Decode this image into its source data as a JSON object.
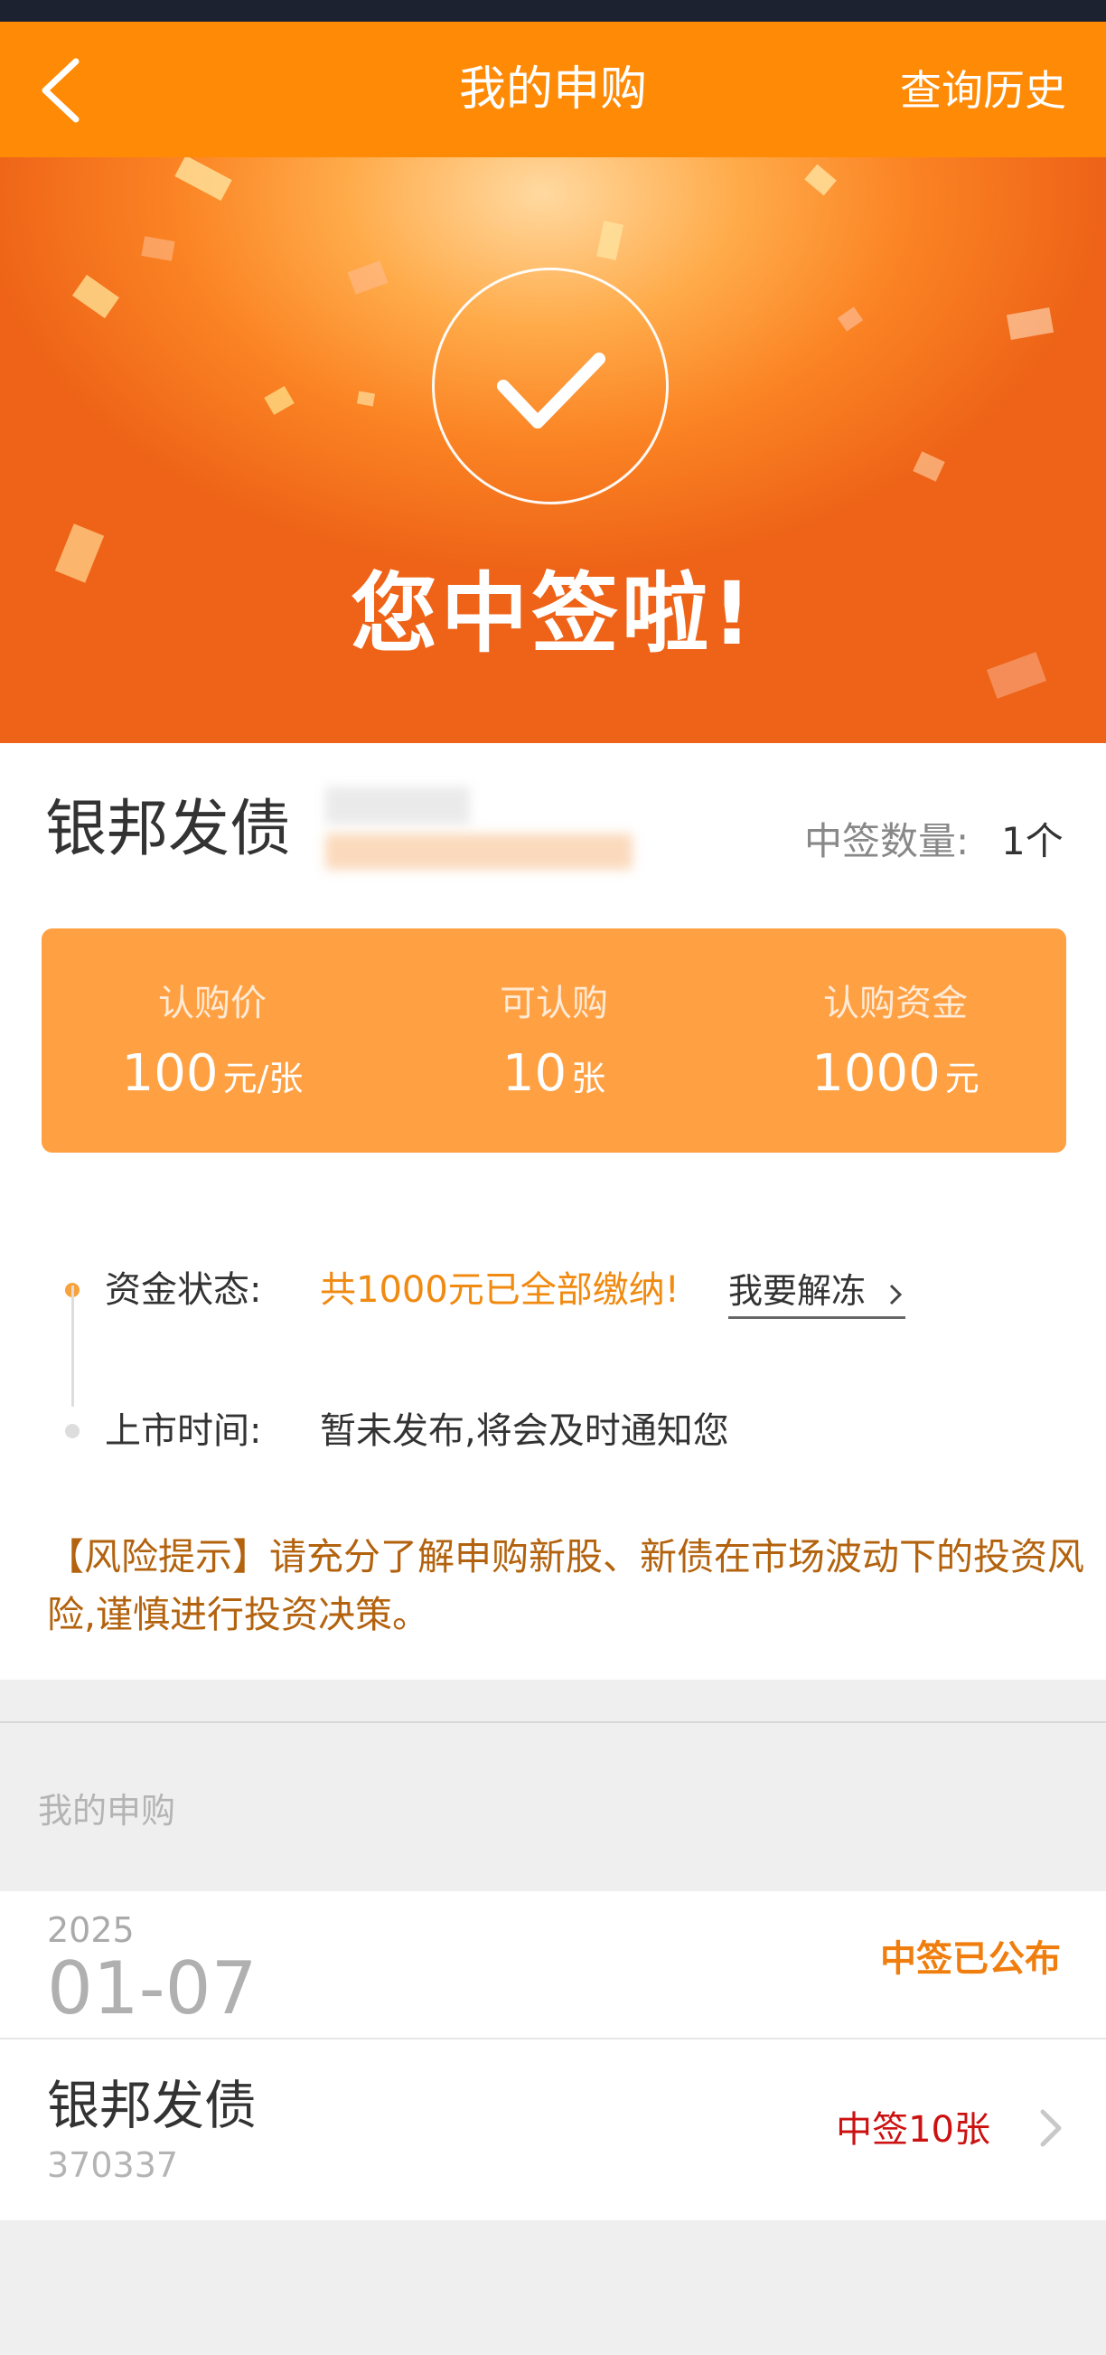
{
  "nav": {
    "title": "我的申购",
    "history_link": "查询历史"
  },
  "banner": {
    "title": "您中签啦!"
  },
  "subscription": {
    "bond_name": "银邦发债",
    "win_count_label": "中签数量:",
    "win_count_value": "1个",
    "summary": [
      {
        "label": "认购价",
        "value": "100",
        "unit": "元/张"
      },
      {
        "label": "可认购",
        "value": "10",
        "unit": "张"
      },
      {
        "label": "认购资金",
        "value": "1000",
        "unit": "元"
      }
    ],
    "fund_status": {
      "label": "资金状态:",
      "value": "共1000元已全部缴纳!",
      "action": "我要解冻"
    },
    "listing": {
      "label": "上市时间:",
      "value": "暂未发布,将会及时通知您"
    },
    "risk_notice": "【风险提示】请充分了解申购新股、新债在市场波动下的投资风险,谨慎进行投资决策。"
  },
  "history": {
    "section_title": "我的申购",
    "date_year": "2025",
    "date_md": "01-07",
    "date_status": "中签已公布",
    "item": {
      "name": "银邦发债",
      "code": "370337",
      "result": "中签10张"
    }
  },
  "colors": {
    "brand_orange": "#ff8a06",
    "summary_orange": "#ffa042",
    "status_orange": "#f07e0e",
    "risk_brown": "#b3620d",
    "result_red": "#cc1111"
  }
}
